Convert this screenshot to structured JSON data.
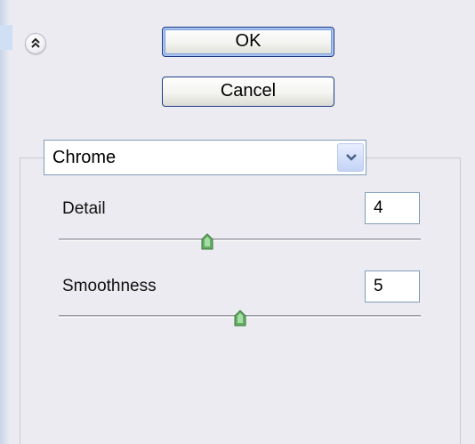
{
  "toolbar": {
    "collapse_icon": "double-chevron-up-icon",
    "ok_label": "OK",
    "cancel_label": "Cancel"
  },
  "preset": {
    "selected": "Chrome",
    "dropdown_icon": "chevron-down-icon"
  },
  "params": [
    {
      "label": "Detail",
      "value": "4",
      "slider_fraction": 0.41
    },
    {
      "label": "Smoothness",
      "value": "5",
      "slider_fraction": 0.5
    }
  ],
  "colors": {
    "panel_bg": "#ecebf1",
    "button_border": "#1c3c86",
    "slider_thumb": "#5ea85e"
  }
}
